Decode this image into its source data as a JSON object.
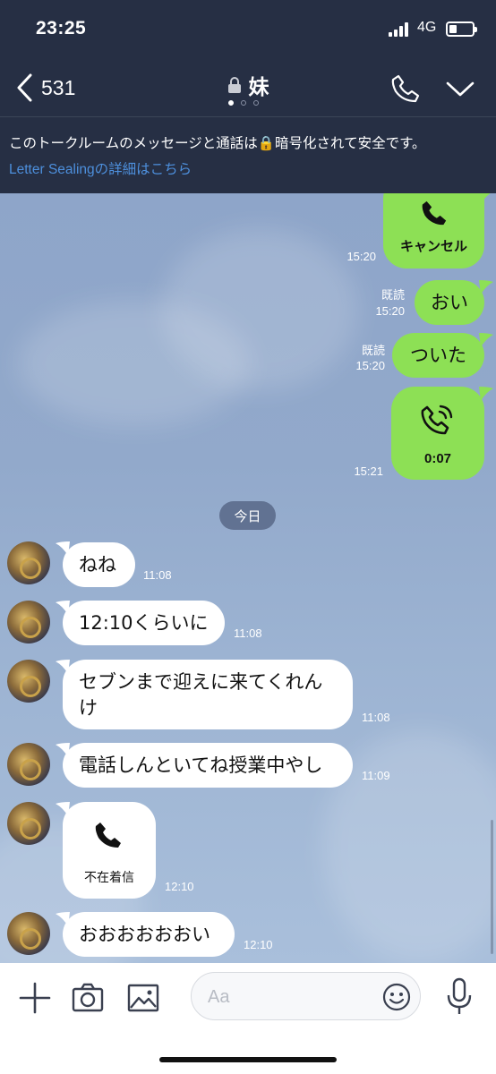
{
  "status_bar": {
    "time": "23:25",
    "network": "4G"
  },
  "header": {
    "back_count": "531",
    "title": "妹"
  },
  "encryption_notice": {
    "text": "このトークルームのメッセージと通話は🔒暗号化されて安全です。",
    "link": "Letter Sealingの詳細はこちら"
  },
  "outgoing": [
    {
      "type": "call",
      "label": "キャンセル",
      "time": "15:20"
    },
    {
      "type": "text",
      "text": "おい",
      "read": "既読",
      "time": "15:20"
    },
    {
      "type": "text",
      "text": "ついた",
      "read": "既読",
      "time": "15:20"
    },
    {
      "type": "call",
      "label": "0:07",
      "time": "15:21"
    }
  ],
  "date_separator": "今日",
  "incoming": [
    {
      "text": "ねね",
      "time": "11:08"
    },
    {
      "text": "12:10くらいに",
      "time": "11:08"
    },
    {
      "text_line1": "セブンまで迎えに来てくれん",
      "text_line2": "け",
      "time": "11:08"
    },
    {
      "text": "電話しんといてね授業中やし",
      "time": "11:09"
    },
    {
      "type": "missed-call",
      "label": "不在着信",
      "time": "12:10"
    },
    {
      "text": "おおおおおおい",
      "time": "12:10"
    }
  ],
  "input": {
    "placeholder": "Aa"
  },
  "colors": {
    "outgoing_bubble": "#8de055",
    "header_bg": "#262f44",
    "link": "#4d8fdc"
  }
}
